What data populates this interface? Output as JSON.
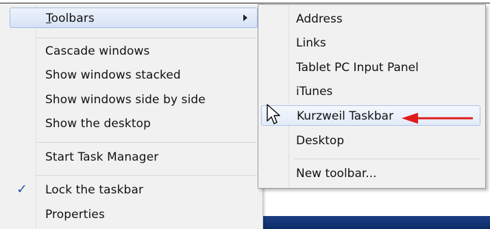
{
  "context_menu": {
    "items": [
      {
        "label": "Toolbars",
        "has_submenu": true,
        "highlighted": true
      },
      {
        "label": "Cascade windows"
      },
      {
        "label": "Show windows stacked"
      },
      {
        "label": "Show windows side by side"
      },
      {
        "label": "Show the desktop"
      },
      {
        "label": "Start Task Manager"
      },
      {
        "label": "Lock the taskbar",
        "checked": true
      },
      {
        "label": "Properties"
      }
    ]
  },
  "toolbars_submenu": {
    "items": [
      {
        "label": "Address"
      },
      {
        "label": "Links"
      },
      {
        "label": "Tablet PC Input Panel"
      },
      {
        "label": "iTunes"
      },
      {
        "label": "Kurzweil Taskbar",
        "highlighted": true
      },
      {
        "label": "Desktop"
      },
      {
        "label": "New toolbar..."
      }
    ]
  },
  "colors": {
    "menu_background": "#f1f1f1",
    "highlight_border": "#9fbbe6",
    "check_color": "#2a4fb0",
    "annotation_arrow": "#e01b1b",
    "taskbar_band": "#1c3f84"
  },
  "icons": [
    "submenu-arrow-icon",
    "checkmark-icon",
    "mouse-pointer-icon",
    "red-annotation-arrow-icon"
  ]
}
